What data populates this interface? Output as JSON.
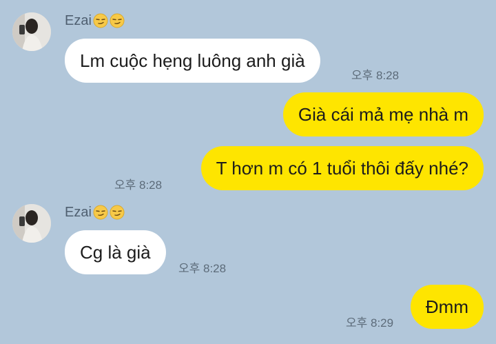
{
  "contact": {
    "name": "Ezai",
    "emoji_icons": [
      "smirk-face-icon",
      "smirk-face-icon"
    ]
  },
  "messages": [
    {
      "direction": "in",
      "text": "Lm cuộc hẹng luông anh già",
      "time": "오후 8:28"
    },
    {
      "direction": "out",
      "text": "Già cái mả mẹ nhà m",
      "time": ""
    },
    {
      "direction": "out",
      "text": "T hơn m có 1 tuổi thôi đấy nhé?",
      "time": "오후 8:28"
    },
    {
      "direction": "in",
      "text": "Cg là già",
      "time": "오후 8:28"
    },
    {
      "direction": "out",
      "text": "Đmm",
      "time": "오후 8:29"
    }
  ],
  "colors": {
    "background": "#b2c7da",
    "incoming_bubble": "#ffffff",
    "outgoing_bubble": "#fee500",
    "timestamp": "#5c6b79"
  }
}
